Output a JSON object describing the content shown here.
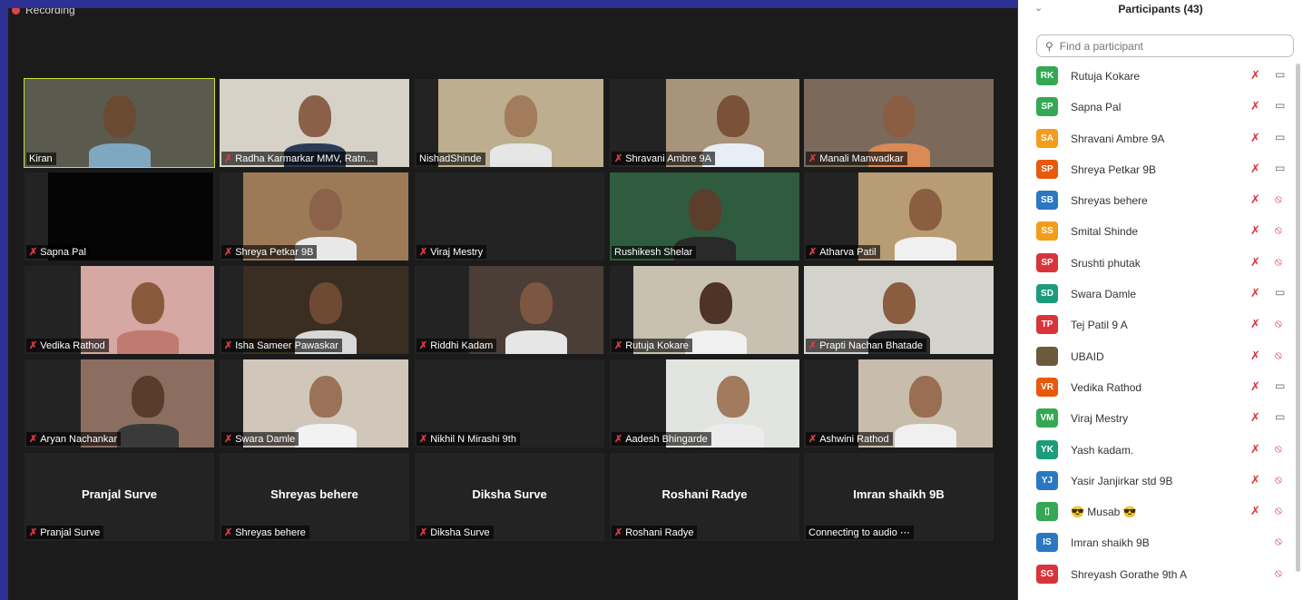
{
  "recording_label": "Recording",
  "panel": {
    "title": "Participants (43)",
    "search_placeholder": "Find a participant",
    "participants": [
      {
        "initials": "RK",
        "name": "Rutuja Kokare",
        "color": "#34a853",
        "mic": "muted",
        "cam": "on"
      },
      {
        "initials": "SP",
        "name": "Sapna Pal",
        "color": "#34a853",
        "mic": "muted",
        "cam": "on"
      },
      {
        "initials": "SA",
        "name": "Shravani Ambre 9A",
        "color": "#f39c1b",
        "mic": "muted",
        "cam": "on"
      },
      {
        "initials": "SP",
        "name": "Shreya Petkar 9B",
        "color": "#e8590c",
        "mic": "muted",
        "cam": "on"
      },
      {
        "initials": "SB",
        "name": "Shreyas behere",
        "color": "#2b78c2",
        "mic": "muted",
        "cam": "off"
      },
      {
        "initials": "SS",
        "name": "Smital Shinde",
        "color": "#f39c1b",
        "mic": "muted",
        "cam": "off"
      },
      {
        "initials": "SP",
        "name": "Srushti phutak",
        "color": "#d9343a",
        "mic": "muted",
        "cam": "off"
      },
      {
        "initials": "SD",
        "name": "Swara Damle",
        "color": "#1c9c7c",
        "mic": "muted",
        "cam": "on"
      },
      {
        "initials": "TP",
        "name": "Tej Patil 9 A",
        "color": "#d9343a",
        "mic": "muted",
        "cam": "off"
      },
      {
        "initials": "",
        "name": "UBAID",
        "color": "#6b5a3c",
        "mic": "muted",
        "cam": "off"
      },
      {
        "initials": "VR",
        "name": "Vedika Rathod",
        "color": "#e8590c",
        "mic": "muted",
        "cam": "on"
      },
      {
        "initials": "VM",
        "name": "Viraj Mestry",
        "color": "#34a853",
        "mic": "muted",
        "cam": "on"
      },
      {
        "initials": "YK",
        "name": "Yash kadam.",
        "color": "#1c9c7c",
        "mic": "muted",
        "cam": "off"
      },
      {
        "initials": "YJ",
        "name": "Yasir Janjirkar std 9B",
        "color": "#2b78c2",
        "mic": "muted",
        "cam": "off"
      },
      {
        "initials": "▯",
        "name": "😎 Musab 😎",
        "color": "#34a853",
        "mic": "muted",
        "cam": "off"
      },
      {
        "initials": "IS",
        "name": "Imran shaikh 9B",
        "color": "#2b78c2",
        "mic": "none",
        "cam": "off"
      },
      {
        "initials": "SG",
        "name": "Shreyash Gorathe 9th A",
        "color": "#d9343a",
        "mic": "none",
        "cam": "off"
      }
    ]
  },
  "tiles": [
    {
      "name": "Kiran",
      "muted": false,
      "active": true,
      "video": "#5a5a4e",
      "skin": "#6b4a32",
      "shirt": "#7fa8c0"
    },
    {
      "name": "Radha Karmarkar MMV, Ratn...",
      "muted": true,
      "video": "#d6d2c8",
      "skin": "#8a6048",
      "shirt": "#2b3b55"
    },
    {
      "name": "NishadShinde",
      "muted": false,
      "video": "#bcae8e",
      "skin": "#a27c5c",
      "shirt": "#e6e6e6"
    },
    {
      "name": "Shravani Ambre 9A",
      "muted": true,
      "video": "#a8947a",
      "skin": "#7a5238",
      "shirt": "#e8eef5"
    },
    {
      "name": "Manali Manwadkar",
      "muted": true,
      "video": "#7b6a5c",
      "skin": "#8a5e42",
      "shirt": "#d98a55"
    },
    {
      "name": "Sapna Pal",
      "muted": true,
      "video": "#050505",
      "skin": "",
      "shirt": ""
    },
    {
      "name": "Shreya Petkar 9B",
      "muted": true,
      "video": "#9c7a58",
      "skin": "#8a6348",
      "shirt": "#e8e8e8"
    },
    {
      "name": "Viraj Mestry",
      "muted": true,
      "video": "",
      "skin": "",
      "shirt": ""
    },
    {
      "name": "Rushikesh Shelar",
      "muted": false,
      "video": "#2f5b3e",
      "skin": "#5c3e2c",
      "shirt": "#2a2a2a"
    },
    {
      "name": "Atharva Patil",
      "muted": true,
      "video": "#b89c74",
      "skin": "#8a5e40",
      "shirt": "#f0f0f0"
    },
    {
      "name": "Vedika Rathod",
      "muted": true,
      "video": "#d5a8a4",
      "skin": "#8a5a3e",
      "shirt": "#c07a70"
    },
    {
      "name": "Isha Sameer Pawaskar",
      "muted": true,
      "video": "#3a2d22",
      "skin": "#6e4a32",
      "shirt": "#d8d8d8"
    },
    {
      "name": "Riddhi Kadam",
      "muted": true,
      "video": "#4a3e36",
      "skin": "#7c5640",
      "shirt": "#e6e6e6"
    },
    {
      "name": "Rutuja Kokare",
      "muted": true,
      "video": "#c8c0b0",
      "skin": "#4e3426",
      "shirt": "#f0f0f0"
    },
    {
      "name": "Prapti Nachan Bhatade",
      "muted": true,
      "video": "#d4d2cc",
      "skin": "#8a5c40",
      "shirt": "#2a2a2a"
    },
    {
      "name": "Aryan Nachankar",
      "muted": true,
      "video": "#8c6e60",
      "skin": "#5a3c2c",
      "shirt": "#3a3a3a"
    },
    {
      "name": "Swara Damle",
      "muted": true,
      "video": "#d0c6ba",
      "skin": "#9a7258",
      "shirt": "#f2f2f2"
    },
    {
      "name": "Nikhil N Mirashi 9th",
      "muted": true,
      "video": "",
      "skin": "",
      "shirt": ""
    },
    {
      "name": "Aadesh  Bhingarde",
      "muted": true,
      "video": "#e2e4e0",
      "skin": "#a27a5e",
      "shirt": "#ececec"
    },
    {
      "name": "Ashwini Rathod",
      "muted": true,
      "video": "#c8bcac",
      "skin": "#9a6e52",
      "shirt": "#f0f0f0"
    },
    {
      "name": "Pranjal Surve",
      "muted": true,
      "video": "",
      "skin": "",
      "shirt": "",
      "big": "Pranjal Surve"
    },
    {
      "name": "Shreyas behere",
      "muted": true,
      "video": "",
      "skin": "",
      "shirt": "",
      "big": "Shreyas behere"
    },
    {
      "name": "Diksha Surve",
      "muted": true,
      "video": "",
      "skin": "",
      "shirt": "",
      "big": "Diksha Surve"
    },
    {
      "name": "Roshani Radye",
      "muted": true,
      "video": "",
      "skin": "",
      "shirt": "",
      "big": "Roshani Radye"
    },
    {
      "name": "Connecting to audio ⋯",
      "muted": false,
      "video": "",
      "skin": "",
      "shirt": "",
      "big": "Imran shaikh 9B"
    }
  ]
}
